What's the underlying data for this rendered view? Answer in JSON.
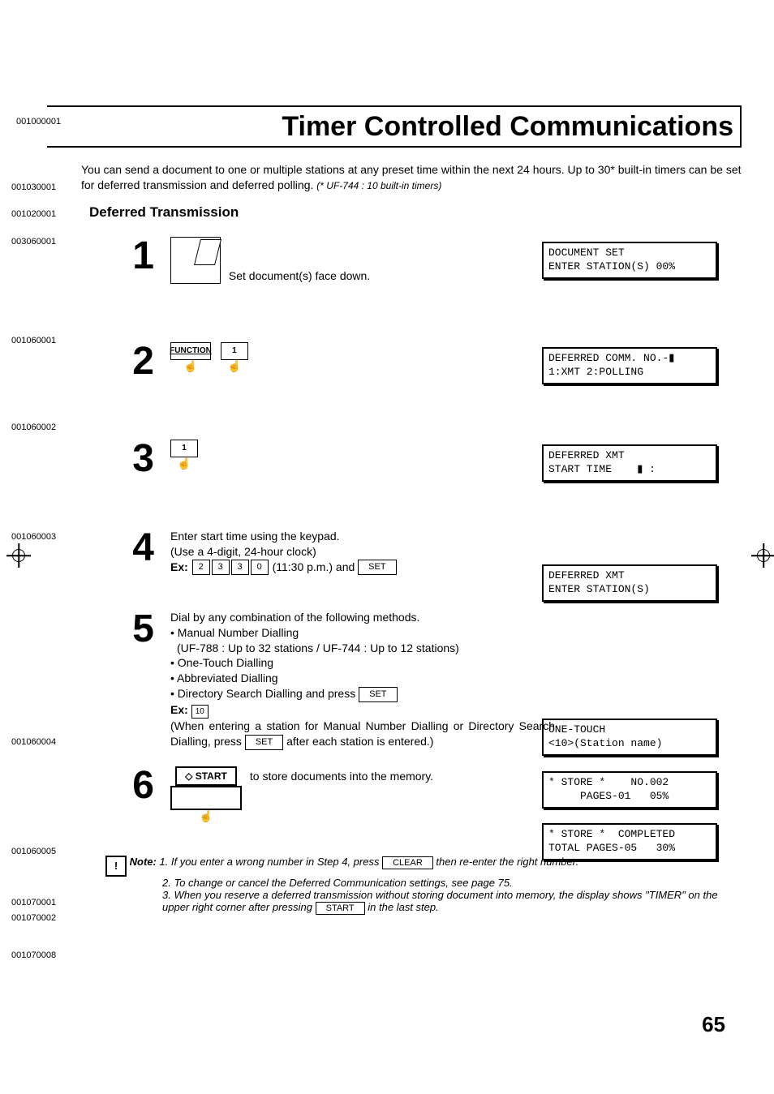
{
  "header": {
    "topcode": "001000001",
    "title": "Timer Controlled Communications"
  },
  "intro": {
    "code": "001030001",
    "text": "You can send a document to one or multiple stations at any preset time within the next 24 hours. Up to 30* built-in timers can be set for deferred transmission and deferred polling.",
    "note": "(* UF-744 : 10 built-in timers)"
  },
  "section": {
    "code": "001020001",
    "title": "Deferred Transmission"
  },
  "steps": {
    "s1": {
      "code": "003060001",
      "num": "1",
      "text": "Set document(s) face down.",
      "display": "DOCUMENT SET\nENTER STATION(S) 00%"
    },
    "s2": {
      "code": "001060001",
      "num": "2",
      "btn1": "FUNCTION",
      "btn2": "1",
      "display": "DEFERRED COMM. NO.-▮\n1:XMT 2:POLLING"
    },
    "s3": {
      "code": "001060002",
      "num": "3",
      "btn": "1",
      "display": "DEFERRED XMT\nSTART TIME    ▮ :"
    },
    "s4": {
      "code": "001060003",
      "num": "4",
      "line1": "Enter start time using the keypad.",
      "line2": "(Use a 4-digit, 24-hour clock)",
      "ex": "Ex:",
      "k1": "2",
      "k2": "3",
      "k3": "3",
      "k4": "0",
      "extext": "(11:30 p.m.) and",
      "setkey": "SET",
      "display": "DEFERRED XMT\nENTER STATION(S)"
    },
    "s5": {
      "code": "001060004",
      "num": "5",
      "line1": "Dial by any combination of the following methods.",
      "b1": "• Manual Number Dialling",
      "b1sub": "(UF-788 : Up to 32 stations / UF-744 : Up to 12 stations)",
      "b2": "• One-Touch Dialling",
      "b3": "• Abbreviated Dialling",
      "b4": "• Directory Search Dialling and press",
      "setkey": "SET",
      "ex": "Ex:",
      "exkey": "10",
      "tail": "(When entering a station for Manual Number Dialling or Directory Search Dialling, press",
      "tail2": "after each station is entered.)",
      "display": "ONE-TOUCH\n<10>(Station name)"
    },
    "s6": {
      "code": "001060005",
      "num": "6",
      "startlabel": "◇ START",
      "text": "to store documents into the memory.",
      "display1": "* STORE *    NO.002\n     PAGES-01   05%",
      "display2": "* STORE *  COMPLETED\nTOTAL PAGES-05   30%"
    }
  },
  "notes": {
    "code1": "001070001",
    "code2": "001070002",
    "code3": "001070008",
    "label": "Note:",
    "n1a": "1. If you enter a wrong number in Step 4, press",
    "n1key": "CLEAR",
    "n1b": "then re-enter the right number.",
    "n2": "2. To change or cancel the Deferred Communication settings, see page 75.",
    "n3a": "3. When you reserve a deferred transmission without storing document into memory, the display shows \"TIMER\" on the upper right corner after pressing",
    "n3key": "START",
    "n3b": "in the last step."
  },
  "page_number": "65"
}
